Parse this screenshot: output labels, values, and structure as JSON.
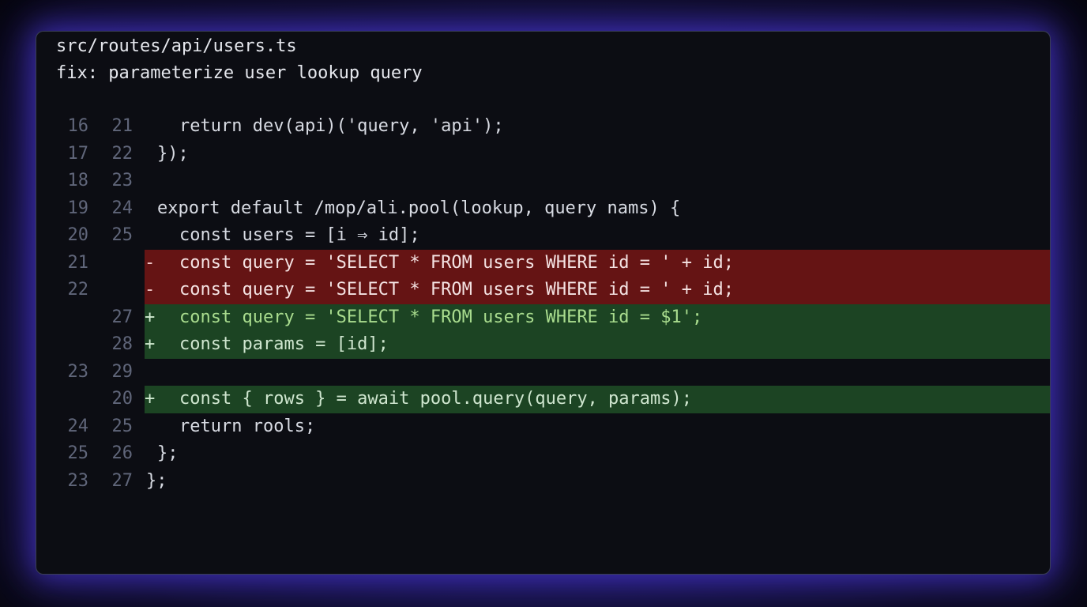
{
  "header": {
    "file_path": "src/routes/api/users.ts",
    "commit_message": "fix: parameterize user lookup query"
  },
  "diff_lines": [
    {
      "type": "ctx",
      "old": "16",
      "new": "21",
      "marker": "",
      "indent": 2,
      "code": "return dev(api)('query, 'api');"
    },
    {
      "type": "ctx",
      "old": "17",
      "new": "22",
      "marker": "",
      "indent": 1,
      "code": "});"
    },
    {
      "type": "ctx",
      "old": "18",
      "new": "23",
      "marker": "",
      "indent": 0,
      "code": ""
    },
    {
      "type": "ctx",
      "old": "19",
      "new": "24",
      "marker": "",
      "indent": 1,
      "code": "export default /mop/ali.pool(lookup, query nams) {"
    },
    {
      "type": "ctx",
      "old": "20",
      "new": "25",
      "marker": "",
      "indent": 2,
      "code": "const users = [i ⇒ id];"
    },
    {
      "type": "del",
      "old": "21",
      "new": "",
      "marker": "-",
      "indent": 2,
      "code": "const query = 'SELECT * FROM users WHERE id = ' + id;"
    },
    {
      "type": "del",
      "old": "22",
      "new": "",
      "marker": "-",
      "indent": 2,
      "code": "const query = 'SELECT * FROM users WHERE id = ' + id;"
    },
    {
      "type": "add",
      "old": "",
      "new": "27",
      "marker": "+",
      "indent": 2,
      "code": "const query = 'SELECT * FROM users WHERE id = $1';"
    },
    {
      "type": "add",
      "old": "",
      "new": "28",
      "marker": "+",
      "indent": 2,
      "code": "const params = [id];"
    },
    {
      "type": "ctx",
      "old": "23",
      "new": "29",
      "marker": "",
      "indent": 0,
      "code": ""
    },
    {
      "type": "add",
      "old": "",
      "new": "20",
      "marker": "+",
      "indent": 2,
      "code": "const { rows } = await pool.query(query, params);"
    },
    {
      "type": "ctx",
      "old": "24",
      "new": "25",
      "marker": "",
      "indent": 2,
      "code": "return rools;"
    },
    {
      "type": "ctx",
      "old": "25",
      "new": "26",
      "marker": "",
      "indent": 1,
      "code": "};"
    },
    {
      "type": "ctx",
      "old": "23",
      "new": "27",
      "marker": "",
      "indent": 0,
      "code": "};"
    }
  ],
  "colors": {
    "deleted_line_bg": "#651414",
    "added_line_bg": "#1c4423",
    "glow": "#5a3ff0",
    "line_number": "#60667a"
  }
}
